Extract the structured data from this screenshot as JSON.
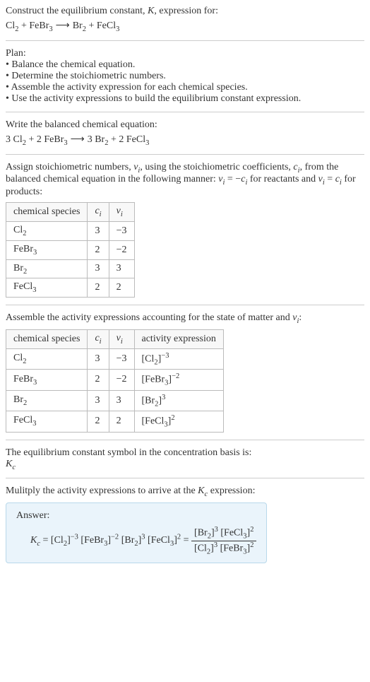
{
  "intro": {
    "line1": "Construct the equilibrium constant, ",
    "K": "K",
    "line1b": ", expression for:"
  },
  "eq_unbalanced": {
    "r1": "Cl",
    "r1sub": "2",
    "plus1": " + ",
    "r2": "FeBr",
    "r2sub": "3",
    "arrow": " ⟶ ",
    "p1": "Br",
    "p1sub": "2",
    "plus2": " + ",
    "p2": "FeCl",
    "p2sub": "3"
  },
  "plan": {
    "title": "Plan:",
    "b1": "• Balance the chemical equation.",
    "b2": "• Determine the stoichiometric numbers.",
    "b3": "• Assemble the activity expression for each chemical species.",
    "b4": "• Use the activity expressions to build the equilibrium constant expression."
  },
  "balanced_title": "Write the balanced chemical equation:",
  "eq_balanced": {
    "c1": "3 ",
    "r1": "Cl",
    "r1sub": "2",
    "plus1": " + ",
    "c2": "2 ",
    "r2": "FeBr",
    "r2sub": "3",
    "arrow": " ⟶ ",
    "c3": "3 ",
    "p1": "Br",
    "p1sub": "2",
    "plus2": " + ",
    "c4": "2 ",
    "p2": "FeCl",
    "p2sub": "3"
  },
  "stoich": {
    "text1": "Assign stoichiometric numbers, ",
    "nu": "ν",
    "nusub": "i",
    "text2": ", using the stoichiometric coefficients, ",
    "c": "c",
    "csub": "i",
    "text3": ", from the balanced chemical equation in the following manner: ",
    "rel1a": "ν",
    "rel1asub": "i",
    "rel1b": " = −",
    "rel1c": "c",
    "rel1csub": "i",
    "text4": " for reactants and ",
    "rel2a": "ν",
    "rel2asub": "i",
    "rel2b": " = ",
    "rel2c": "c",
    "rel2csub": "i",
    "text5": " for products:"
  },
  "table1": {
    "h1": "chemical species",
    "h2a": "c",
    "h2sub": "i",
    "h3a": "ν",
    "h3sub": "i",
    "rows": [
      {
        "sp": "Cl",
        "spsub": "2",
        "c": "3",
        "v": "−3"
      },
      {
        "sp": "FeBr",
        "spsub": "3",
        "c": "2",
        "v": "−2"
      },
      {
        "sp": "Br",
        "spsub": "2",
        "c": "3",
        "v": "3"
      },
      {
        "sp": "FeCl",
        "spsub": "3",
        "c": "2",
        "v": "2"
      }
    ]
  },
  "activity_title_a": "Assemble the activity expressions accounting for the state of matter and ",
  "activity_nu": "ν",
  "activity_nusub": "i",
  "activity_title_b": ":",
  "table2": {
    "h1": "chemical species",
    "h2a": "c",
    "h2sub": "i",
    "h3a": "ν",
    "h3sub": "i",
    "h4": "activity expression",
    "rows": [
      {
        "sp": "Cl",
        "spsub": "2",
        "c": "3",
        "v": "−3",
        "ae_sp": "Cl",
        "ae_sub": "2",
        "ae_exp": "−3"
      },
      {
        "sp": "FeBr",
        "spsub": "3",
        "c": "2",
        "v": "−2",
        "ae_sp": "FeBr",
        "ae_sub": "3",
        "ae_exp": "−2"
      },
      {
        "sp": "Br",
        "spsub": "2",
        "c": "3",
        "v": "3",
        "ae_sp": "Br",
        "ae_sub": "2",
        "ae_exp": "3"
      },
      {
        "sp": "FeCl",
        "spsub": "3",
        "c": "2",
        "v": "2",
        "ae_sp": "FeCl",
        "ae_sub": "3",
        "ae_exp": "2"
      }
    ]
  },
  "symbol_text": "The equilibrium constant symbol in the concentration basis is:",
  "Kc_a": "K",
  "Kc_sub": "c",
  "multiply_a": "Mulitply the activity expressions to arrive at the ",
  "multiply_b": " expression:",
  "answer": {
    "label": "Answer:",
    "lhs_a": "K",
    "lhs_sub": "c",
    "eq": " = ",
    "t1_sp": "Cl",
    "t1_sub": "2",
    "t1_exp": "−3",
    "t2_sp": "FeBr",
    "t2_sub": "3",
    "t2_exp": "−2",
    "t3_sp": "Br",
    "t3_sub": "2",
    "t3_exp": "3",
    "t4_sp": "FeCl",
    "t4_sub": "3",
    "t4_exp": "2",
    "eq2": " = ",
    "num1_sp": "Br",
    "num1_sub": "2",
    "num1_exp": "3",
    "num2_sp": "FeCl",
    "num2_sub": "3",
    "num2_exp": "2",
    "den1_sp": "Cl",
    "den1_sub": "2",
    "den1_exp": "3",
    "den2_sp": "FeBr",
    "den2_sub": "3",
    "den2_exp": "2"
  }
}
